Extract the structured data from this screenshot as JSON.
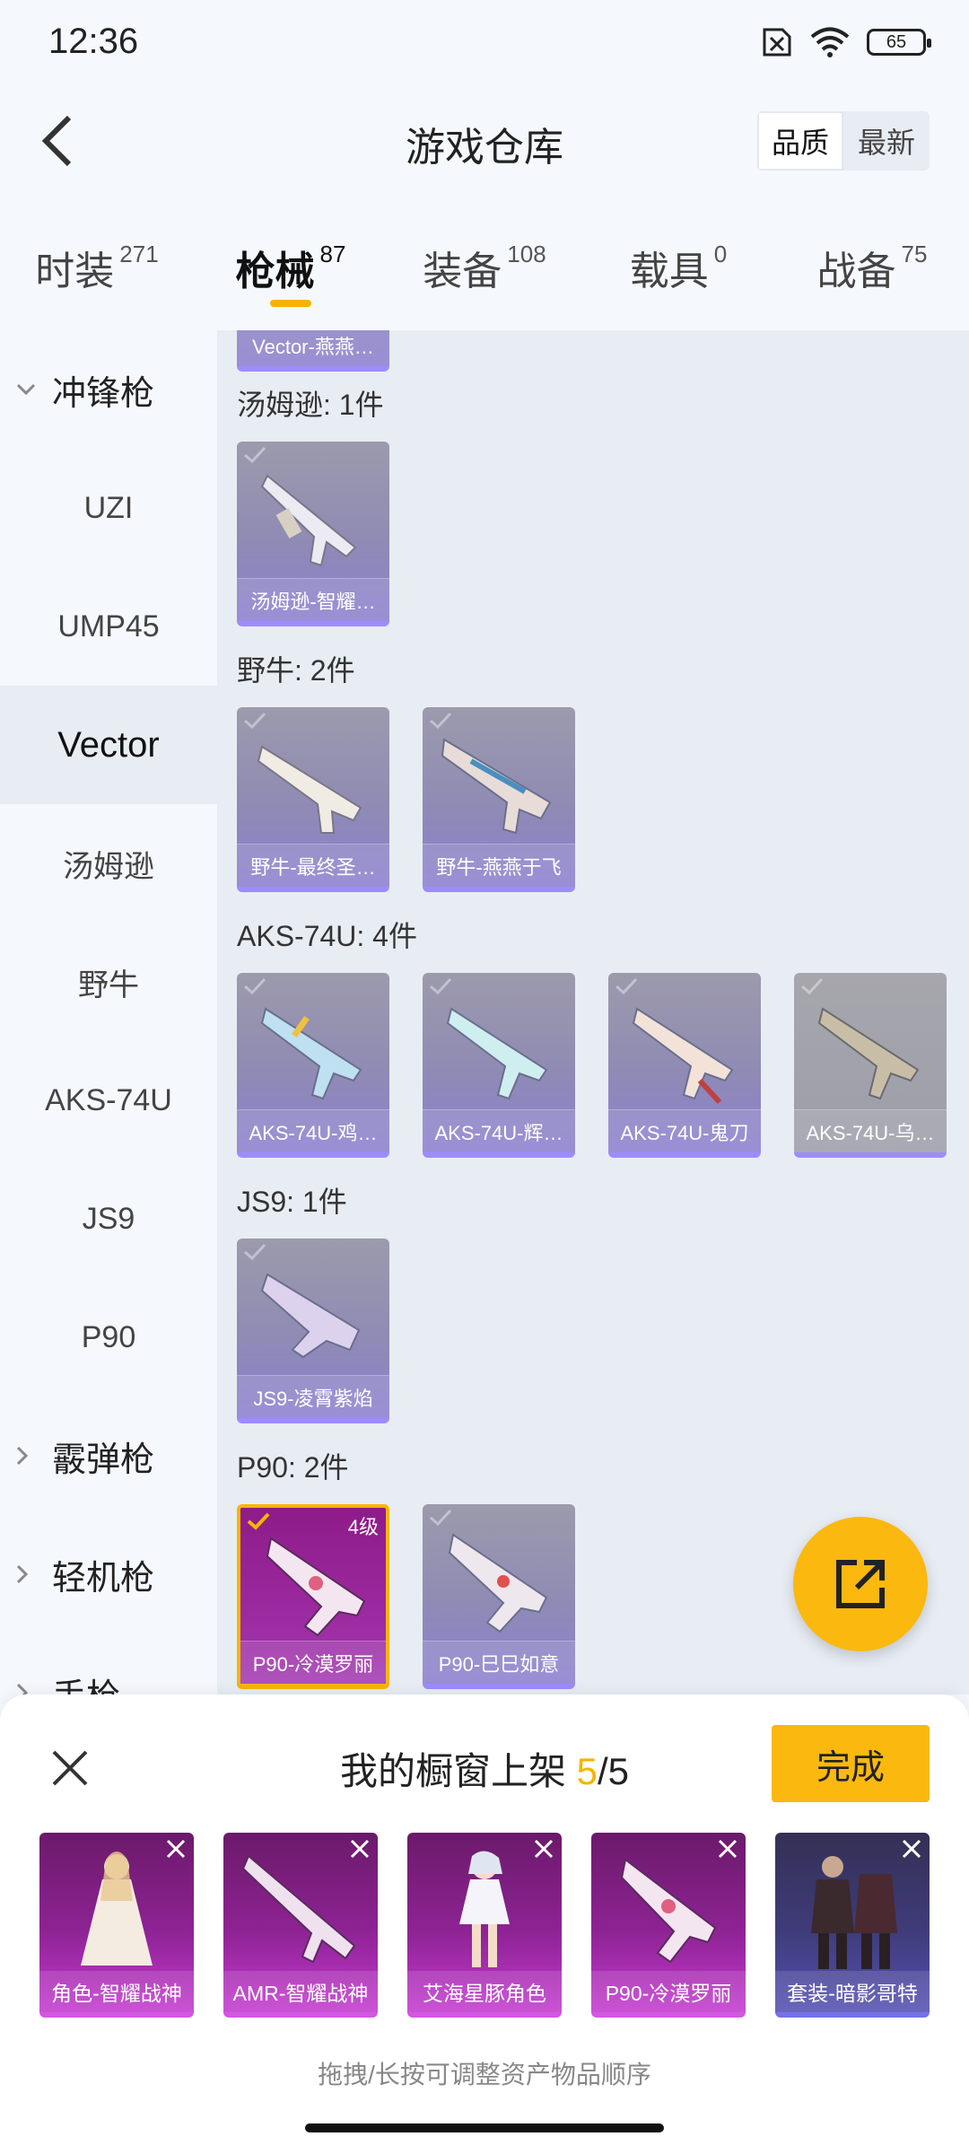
{
  "status_bar": {
    "time": "12:36",
    "battery": "65"
  },
  "header": {
    "title": "游戏仓库",
    "sort": [
      "品质",
      "最新"
    ],
    "sort_active": 0
  },
  "tabs": [
    {
      "label": "时装",
      "count": "271"
    },
    {
      "label": "枪械",
      "count": "87",
      "active": true
    },
    {
      "label": "装备",
      "count": "108"
    },
    {
      "label": "载具",
      "count": "0"
    },
    {
      "label": "战备",
      "count": "75"
    }
  ],
  "sidebar": {
    "group_smg": "冲锋枪",
    "items": [
      "UZI",
      "UMP45",
      "Vector",
      "汤姆逊",
      "野牛",
      "AKS-74U",
      "JS9",
      "P90"
    ],
    "active_item": "Vector",
    "group_shotgun": "霰弹枪",
    "group_lmg": "轻机枪",
    "group_pistol": "手枪"
  },
  "content": {
    "top_partial_label": "Vector-燕燕…",
    "groups": [
      {
        "title": "汤姆逊: 1件",
        "items": [
          "汤姆逊-智耀…"
        ]
      },
      {
        "title": "野牛: 2件",
        "items": [
          "野牛-最终圣…",
          "野牛-燕燕于飞"
        ]
      },
      {
        "title": "AKS-74U: 4件",
        "items": [
          "AKS-74U-鸡…",
          "AKS-74U-辉…",
          "AKS-74U-鬼刀",
          "AKS-74U-乌…"
        ]
      },
      {
        "title": "JS9: 1件",
        "items": [
          "JS9-凌霄紫焰"
        ]
      },
      {
        "title": "P90: 2件",
        "items": [
          "P90-冷漠罗丽",
          "P90-巳巳如意"
        ],
        "selected_level": "4级"
      }
    ]
  },
  "showcase": {
    "title_prefix": "我的橱窗上架 ",
    "current": "5",
    "total": "/5",
    "done": "完成",
    "slots": [
      "角色-智耀战神",
      "AMR-智耀战神",
      "艾海星豚角色",
      "P90-冷漠罗丽",
      "套装-暗影哥特"
    ],
    "hint": "拖拽/长按可调整资产物品顺序"
  },
  "colors": {
    "accent": "#fbb80f",
    "purple_rarity": "#9d8cff",
    "magenta_rarity": "#c43ad0"
  }
}
